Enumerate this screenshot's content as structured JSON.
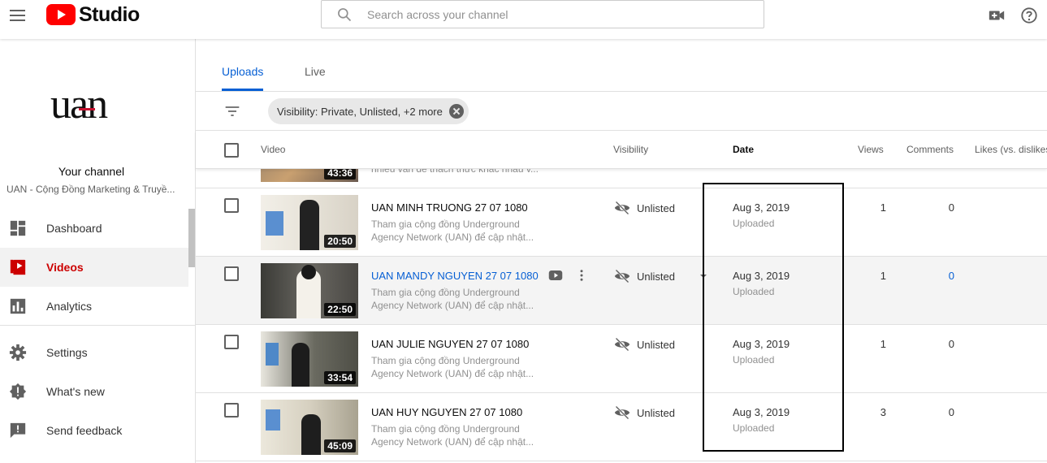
{
  "header": {
    "app_name": "Studio",
    "search_placeholder": "Search across your channel",
    "icons": [
      "menu-icon",
      "search-icon",
      "create-video-icon",
      "help-icon"
    ]
  },
  "sidebar": {
    "channel_logo_text": "uan",
    "channel_title": "Your channel",
    "channel_name": "UAN - Cộng Đồng Marketing & Truyề...",
    "items": [
      {
        "label": "Dashboard",
        "icon": "dashboard-icon"
      },
      {
        "label": "Videos",
        "icon": "videos-icon",
        "active": true
      },
      {
        "label": "Analytics",
        "icon": "analytics-icon"
      },
      {
        "label": "Settings",
        "icon": "gear-icon"
      },
      {
        "label": "What's new",
        "icon": "whats-new-icon"
      },
      {
        "label": "Send feedback",
        "icon": "feedback-icon"
      }
    ]
  },
  "main": {
    "tabs": [
      {
        "label": "Uploads",
        "active": true
      },
      {
        "label": "Live",
        "active": false
      }
    ],
    "filter_chip": "Visibility: Private, Unlisted, +2 more",
    "columns": {
      "video": "Video",
      "visibility": "Visibility",
      "date": "Date",
      "views": "Views",
      "comments": "Comments",
      "likes": "Likes (vs. dislikes)"
    },
    "partial_row": {
      "duration": "43:36",
      "desc": "nhiều vấn đề thách thức khác nhau v..."
    },
    "rows": [
      {
        "title": "UAN MINH TRUONG 27 07 1080",
        "desc1": "Tham gia cộng đồng Underground",
        "desc2": "Agency Network (UAN) để cập nhật...",
        "duration": "20:50",
        "visibility": "Unlisted",
        "date": "Aug 3, 2019",
        "date_status": "Uploaded",
        "views": "1",
        "comments": "0"
      },
      {
        "title": "UAN MANDY NGUYEN 27 07 1080",
        "desc1": "Tham gia cộng đồng Underground",
        "desc2": "Agency Network (UAN) để cập nhật...",
        "duration": "22:50",
        "visibility": "Unlisted",
        "date": "Aug 3, 2019",
        "date_status": "Uploaded",
        "views": "1",
        "comments": "0",
        "hovered": true
      },
      {
        "title": "UAN JULIE NGUYEN 27 07 1080",
        "desc1": "Tham gia cộng đồng Underground",
        "desc2": "Agency Network (UAN) để cập nhật...",
        "duration": "33:54",
        "visibility": "Unlisted",
        "date": "Aug 3, 2019",
        "date_status": "Uploaded",
        "views": "1",
        "comments": "0"
      },
      {
        "title": "UAN HUY NGUYEN 27 07 1080",
        "desc1": "Tham gia cộng đồng Underground",
        "desc2": "Agency Network (UAN) để cập nhật...",
        "duration": "45:09",
        "visibility": "Unlisted",
        "date": "Aug 3, 2019",
        "date_status": "Uploaded",
        "views": "3",
        "comments": "0"
      }
    ]
  },
  "colors": {
    "accent": "#065fd4",
    "active_nav": "#cc0000",
    "brand_red": "#ff0000"
  }
}
